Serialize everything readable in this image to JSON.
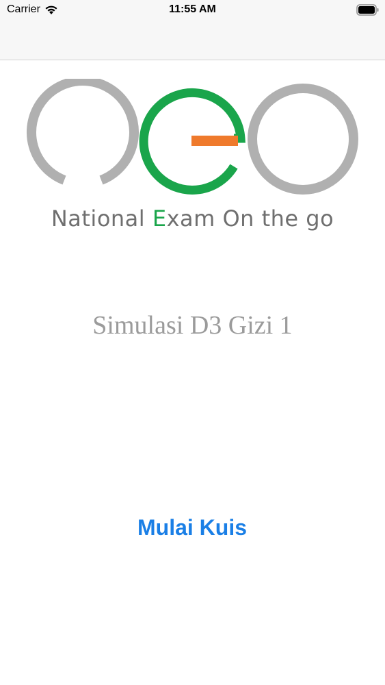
{
  "status_bar": {
    "carrier": "Carrier",
    "time": "11:55 AM"
  },
  "logo": {
    "tagline_before": "National ",
    "tagline_accent": "E",
    "tagline_after": "xam On the go",
    "colors": {
      "gray": "#b0b0b0",
      "green": "#1aa54b",
      "orange": "#ef7a2c"
    }
  },
  "main": {
    "quiz_title": "Simulasi D3 Gizi 1",
    "start_button_label": "Mulai Kuis"
  },
  "theme": {
    "button_color": "#1a7fe6",
    "title_color": "#9b9b9b"
  }
}
